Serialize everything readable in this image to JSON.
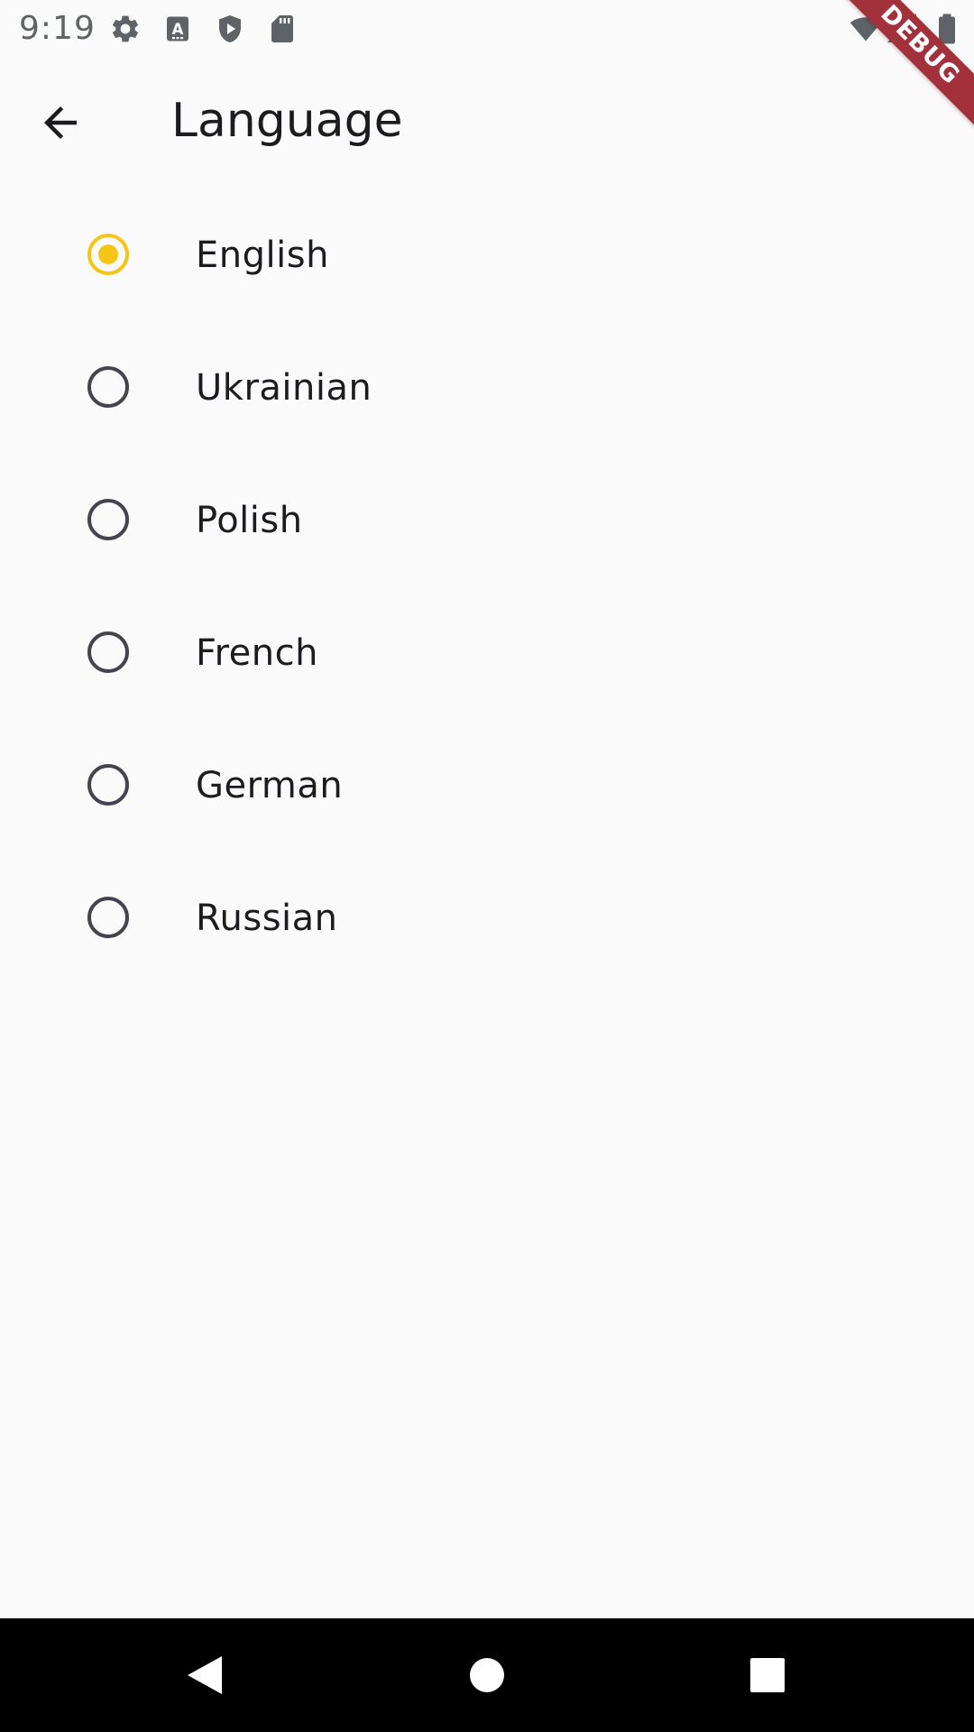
{
  "status_bar": {
    "time": "9:19",
    "icons": [
      "gear-icon",
      "keyboard-a-icon",
      "shield-play-icon",
      "sd-card-icon",
      "wifi-icon",
      "signal-icon",
      "battery-icon"
    ]
  },
  "debug_banner": "DEBUG",
  "app_bar": {
    "back_icon": "arrow-back-icon",
    "title": "Language"
  },
  "languages": [
    {
      "label": "English",
      "selected": true
    },
    {
      "label": "Ukrainian",
      "selected": false
    },
    {
      "label": "Polish",
      "selected": false
    },
    {
      "label": "French",
      "selected": false
    },
    {
      "label": "German",
      "selected": false
    },
    {
      "label": "Russian",
      "selected": false
    }
  ],
  "colors": {
    "accent": "#f5c518",
    "radio_unselected": "#45434d",
    "background": "#fafafa",
    "debug_banner": "#a3313b"
  },
  "nav_bar": {
    "icons": [
      "back-triangle-icon",
      "home-circle-icon",
      "recents-square-icon"
    ]
  }
}
